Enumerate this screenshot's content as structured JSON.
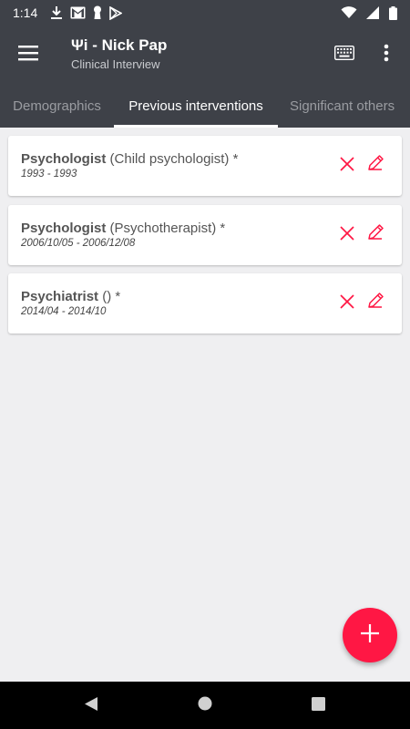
{
  "status_bar": {
    "time": "1:14",
    "left_icons": [
      "download-icon",
      "gmail-icon",
      "keyhole-icon",
      "play-store-icon"
    ],
    "right_icons": [
      "wifi-icon",
      "signal-icon",
      "battery-icon"
    ]
  },
  "app_bar": {
    "title": "Ψi - Nick Pap",
    "subtitle": "Clinical Interview",
    "icons": [
      "menu-icon",
      "keyboard-icon",
      "more-vert-icon"
    ],
    "color": "#3e4148"
  },
  "tabs": [
    {
      "label": "Demographics",
      "active": false
    },
    {
      "label": "Previous interventions",
      "active": true
    },
    {
      "label": "Significant others",
      "active": false
    }
  ],
  "interventions": [
    {
      "type": "Psychologist",
      "detail": "(Child psychologist) *",
      "dates": "1993 - 1993"
    },
    {
      "type": "Psychologist",
      "detail": "(Psychotherapist) *",
      "dates": "2006/10/05 - 2006/12/08"
    },
    {
      "type": "Psychiatrist",
      "detail": "() *",
      "dates": "2014/04 - 2014/10"
    }
  ],
  "card_icons": [
    "delete-icon",
    "edit-icon"
  ],
  "fab": {
    "icon": "add-icon",
    "color": "#ff1744"
  },
  "nav_bar": {
    "icons": [
      "back-icon",
      "home-icon",
      "recents-icon"
    ]
  },
  "colors": {
    "accent": "#ff1744",
    "background": "#efeff1",
    "toolbar": "#3e4148"
  }
}
